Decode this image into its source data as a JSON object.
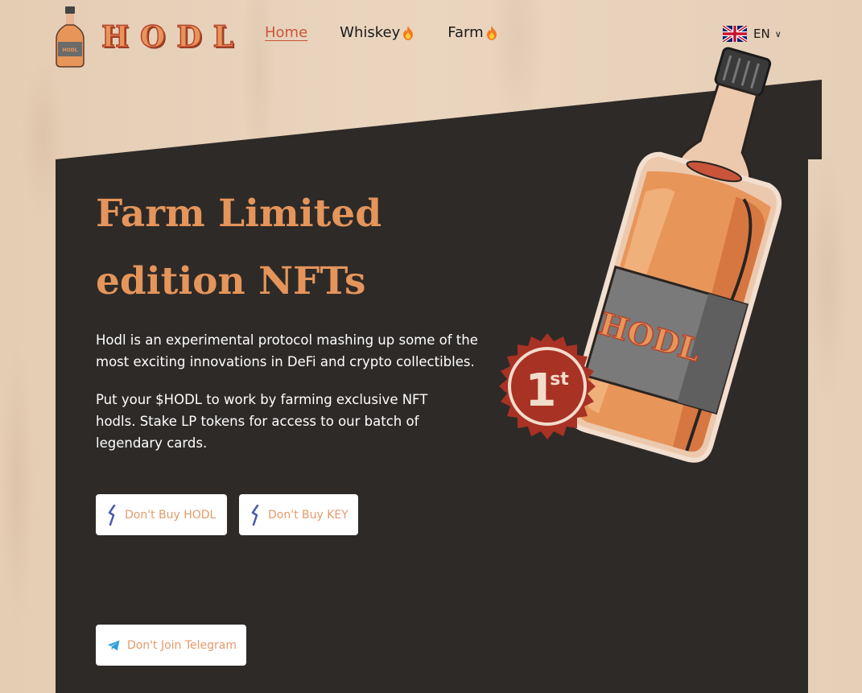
{
  "brand": {
    "name": "HODL",
    "bottle_label": "HODL"
  },
  "nav": {
    "items": [
      {
        "label": "Home",
        "active": true
      },
      {
        "label": "Whiskey",
        "icon": "fire-icon"
      },
      {
        "label": "Farm",
        "icon": "fire-icon"
      }
    ]
  },
  "language": {
    "code": "EN",
    "flag": "uk-flag-icon"
  },
  "hero": {
    "title_line1": "Farm Limited",
    "title_line2": "edition NFTs",
    "paragraph1": "Hodl is an experimental protocol mashing up some of the most exciting innovations in DeFi and crypto collectibles.",
    "paragraph2": "Put your $HODL to work by farming exclusive NFT hodls. Stake LP tokens for access to our batch of legendary cards.",
    "badge_number": "1",
    "badge_suffix": "st",
    "bottle_label": "HODL"
  },
  "buttons": {
    "buy_hodl": "Don't Buy HODL",
    "buy_key": "Don't Buy KEY",
    "join_telegram": "Don't Join Telegram"
  },
  "colors": {
    "background": "#e8d2bb",
    "panel": "#2e2a28",
    "accent": "#e5955a",
    "nav_active": "#c8553a",
    "badge": "#a83224"
  }
}
